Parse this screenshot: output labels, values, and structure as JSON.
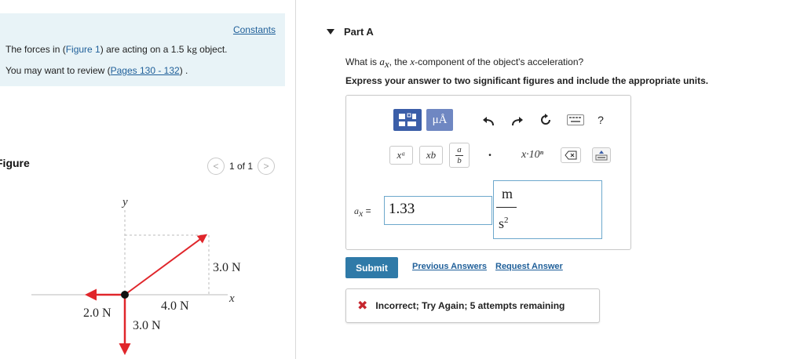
{
  "left": {
    "constants_link": "Constants",
    "problem": {
      "part1": "The forces in (",
      "figure_link": "Figure 1",
      "part2": ") are acting on a 1.5 ",
      "unit": "kg",
      "part3": " object."
    },
    "review": {
      "prefix": "You may want to review (",
      "pages_link": "Pages 130 - 132",
      "suffix": ") ."
    },
    "figure_label": "Figure",
    "pager": {
      "prev": "<",
      "text": "1 of 1",
      "next": ">"
    },
    "figure": {
      "y_label": "y",
      "x_label": "x",
      "force_up_right": "3.0 N",
      "force_left": "2.0 N",
      "force_right": "4.0 N",
      "force_down": "3.0 N",
      "arrow_color": "#e0262b"
    }
  },
  "right": {
    "part_title": "Part A",
    "question_prefix": "What is ",
    "question_var": "a",
    "question_sub": "x",
    "question_mid": ", the ",
    "question_var2": "x",
    "question_suffix": "-component of the object's acceleration?",
    "instructions": "Express your answer to two significant figures and include the appropriate units.",
    "toolbar": {
      "mu_label": "μÅ",
      "help_label": "?",
      "undo_icon": "undo-icon",
      "redo_icon": "redo-icon",
      "reset_icon": "reset-icon",
      "keyboard_icon": "keyboard-icon"
    },
    "palette": {
      "superscript": "xᵃ",
      "subscript": "xb",
      "fraction_top": "a",
      "fraction_bottom": "b",
      "dot": "•",
      "sci": "x·10ⁿ"
    },
    "answer": {
      "label_var": "a",
      "label_sub": "x",
      "label_eq": " =",
      "value": "1.33",
      "unit_numerator": "m",
      "unit_denominator": "s",
      "unit_power": "2"
    },
    "submit_label": "Submit",
    "previous_answers_label": "Previous Answers",
    "request_answer_label": "Request Answer",
    "feedback": "Incorrect; Try Again; 5 attempts remaining",
    "colors": {
      "link": "#1f5f99",
      "submit": "#2f7aa8",
      "error": "#c6262e",
      "toolbar_primary": "#3b5ea8"
    }
  }
}
